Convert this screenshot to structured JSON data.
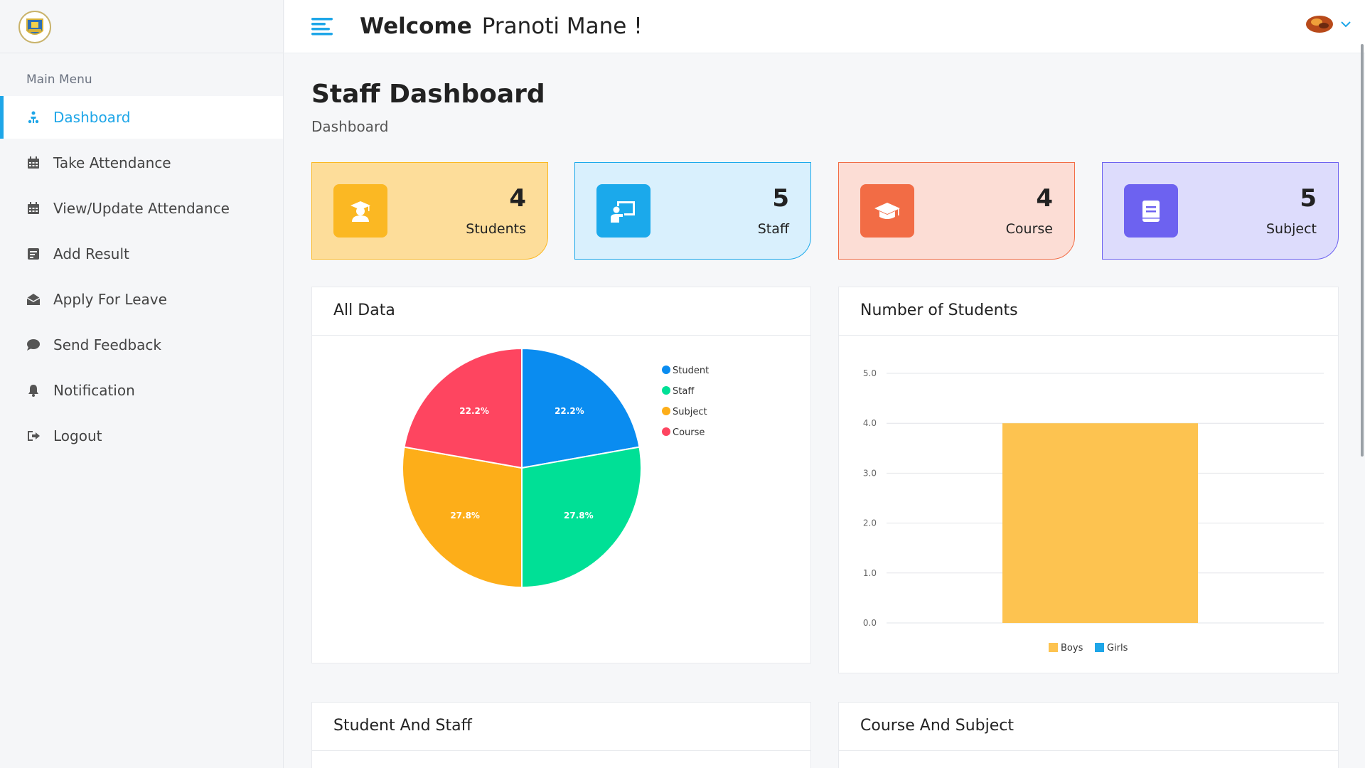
{
  "header": {
    "welcome_bold": "Welcome",
    "user_name": "Pranoti Mane !"
  },
  "sidebar": {
    "heading": "Main Menu",
    "items": [
      {
        "label": "Dashboard",
        "icon": "dashboard-icon",
        "active": true
      },
      {
        "label": "Take Attendance",
        "icon": "calendar-icon"
      },
      {
        "label": "View/Update Attendance",
        "icon": "calendar-icon"
      },
      {
        "label": "Add Result",
        "icon": "document-icon"
      },
      {
        "label": "Apply For Leave",
        "icon": "envelope-icon"
      },
      {
        "label": "Send Feedback",
        "icon": "chat-icon"
      },
      {
        "label": "Notification",
        "icon": "bell-icon"
      },
      {
        "label": "Logout",
        "icon": "logout-icon"
      }
    ]
  },
  "main": {
    "title": "Staff Dashboard",
    "breadcrumb": "Dashboard",
    "cards": [
      {
        "value": "4",
        "label": "Students",
        "icon": "graduate-icon",
        "bg": "#fddd9a",
        "border": "#fbb823",
        "iconbg": "#fbb823"
      },
      {
        "value": "5",
        "label": "Staff",
        "icon": "teacher-board-icon",
        "bg": "#d9f0fd",
        "border": "#1ba9eb",
        "iconbg": "#1ba9eb"
      },
      {
        "value": "4",
        "label": "Course",
        "icon": "mortarboard-icon",
        "bg": "#fcddd5",
        "border": "#f26c45",
        "iconbg": "#f26c45"
      },
      {
        "value": "5",
        "label": "Subject",
        "icon": "book-icon",
        "bg": "#dddcfc",
        "border": "#6d62f0",
        "iconbg": "#6d62f0"
      }
    ],
    "panels": {
      "all_data": "All Data",
      "num_students": "Number of Students",
      "student_staff": "Student And Staff",
      "course_subject": "Course And Subject"
    }
  },
  "chart_data": [
    {
      "type": "pie",
      "categories": [
        "Student",
        "Staff",
        "Subject",
        "Course"
      ],
      "values": [
        22.2,
        27.8,
        27.8,
        22.2
      ],
      "labels": [
        "22.2%",
        "27.8%",
        "27.8%",
        "22.2%"
      ],
      "colors": [
        "#0a8cf0",
        "#00e096",
        "#fdae19",
        "#fe4560"
      ],
      "legend_position": "right"
    },
    {
      "type": "bar",
      "categories": [
        ""
      ],
      "series": [
        {
          "name": "Boys",
          "values": [
            4
          ],
          "color": "#fdc350"
        },
        {
          "name": "Girls",
          "values": [
            0
          ],
          "color": "#1ea6e8"
        }
      ],
      "ylim": [
        0,
        5
      ],
      "yticks": [
        "0.0",
        "1.0",
        "2.0",
        "3.0",
        "4.0",
        "5.0"
      ],
      "grid": true,
      "legend_position": "bottom"
    }
  ]
}
